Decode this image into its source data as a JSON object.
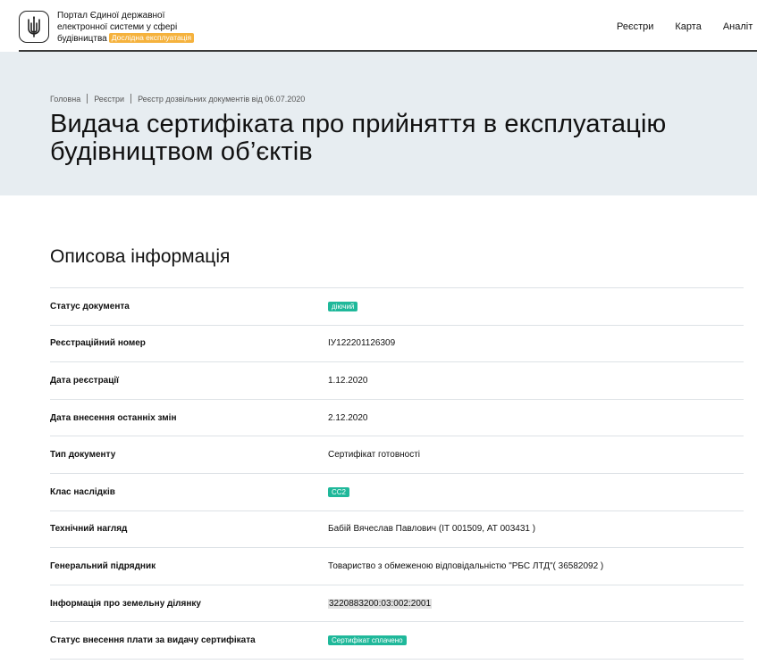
{
  "header": {
    "brand_line1": "Портал Єдиної державної",
    "brand_line2": "електронної системи у сфері",
    "brand_line3": "будівництва",
    "beta_badge": "Дослідна експлуатація",
    "nav": [
      "Реєстри",
      "Карта",
      "Аналіт"
    ]
  },
  "breadcrumbs": [
    "Головна",
    "Реєстри",
    "Реєстр дозвільних документів від 06.07.2020"
  ],
  "page": {
    "title_line1": "Видача сертифіката про прийняття в експлуатацію",
    "title_line2": "будівництвом об’єктів"
  },
  "section": {
    "title": "Описова інформація"
  },
  "rows": [
    {
      "label": "Статус документа",
      "value": "діючий"
    },
    {
      "label": "Реєстраційний номер",
      "value": "ІУ122201126309"
    },
    {
      "label": "Дата реєстрації",
      "value": "1.12.2020"
    },
    {
      "label": "Дата внесення останніх змін",
      "value": "2.12.2020"
    },
    {
      "label": "Тип документу",
      "value": "Сертифікат готовності"
    },
    {
      "label": "Клас наслідків",
      "value": "СС2"
    },
    {
      "label": "Технічний нагляд",
      "value": "Бабій Вячеслав Павлович (ІТ 001509, АТ 003431 )"
    },
    {
      "label": "Генеральний підрядник",
      "value": "Товариство з обмеженою відповідальністю \"РБС ЛТД\"( 36582092 )"
    },
    {
      "label": "Інформація про земельну ділянку",
      "value": "3220883200:03:002:2001"
    },
    {
      "label": "Статус внесення плати за видачу сертифіката",
      "value": "Сертифікат сплачено"
    }
  ],
  "colors": {
    "badge": "#1fb89a",
    "beta": "#f5b23d",
    "hero_bg": "#e7edf1"
  },
  "icons": {
    "emblem": "trident-icon"
  }
}
